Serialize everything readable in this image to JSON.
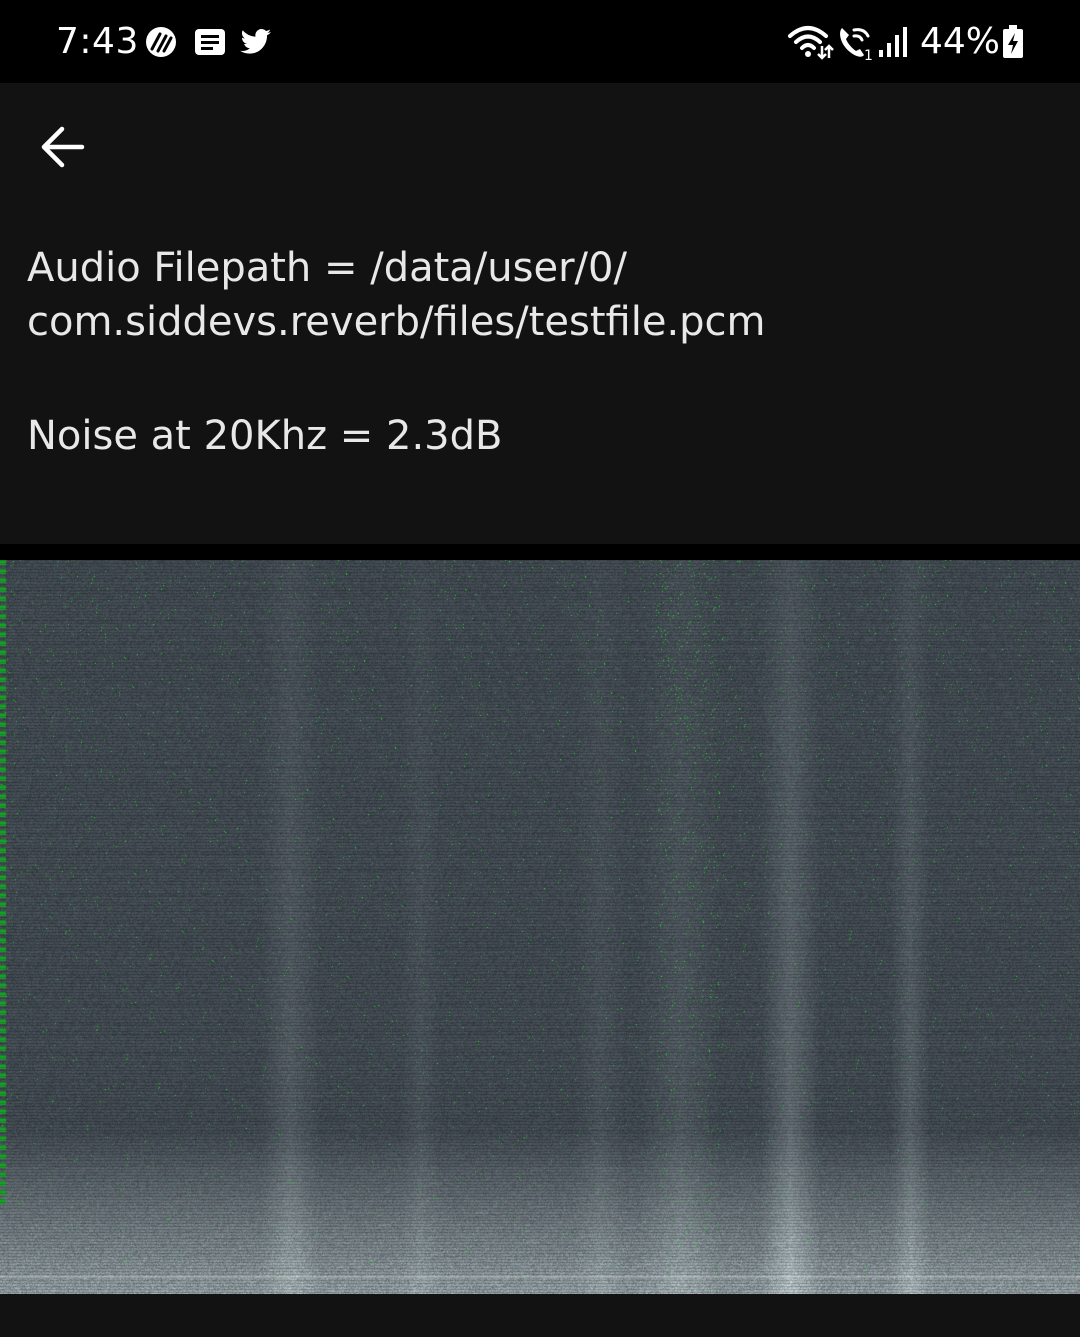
{
  "status_bar": {
    "time": "7:43",
    "notification_icons": [
      "assistant-icon",
      "news-icon",
      "twitter-icon"
    ],
    "status_icons": [
      "wifi-icon",
      "wifi-calling-icon",
      "signal-icon",
      "battery-charging-icon"
    ],
    "battery": "44%"
  },
  "app": {
    "back_icon": "arrow-left-icon",
    "filepath_line1": "Audio Filepath = /data/user/0/",
    "filepath_line2": "com.siddevs.reverb/files/testfile.pcm",
    "noise_text": "Noise at 20Khz = 2.3dB"
  },
  "colors": {
    "app_bar_bg": "#121212",
    "spectrogram_base": "#2a3540",
    "spectrogram_highlight": "#22c22e",
    "spectrogram_noise_floor": "#8a8f92"
  }
}
